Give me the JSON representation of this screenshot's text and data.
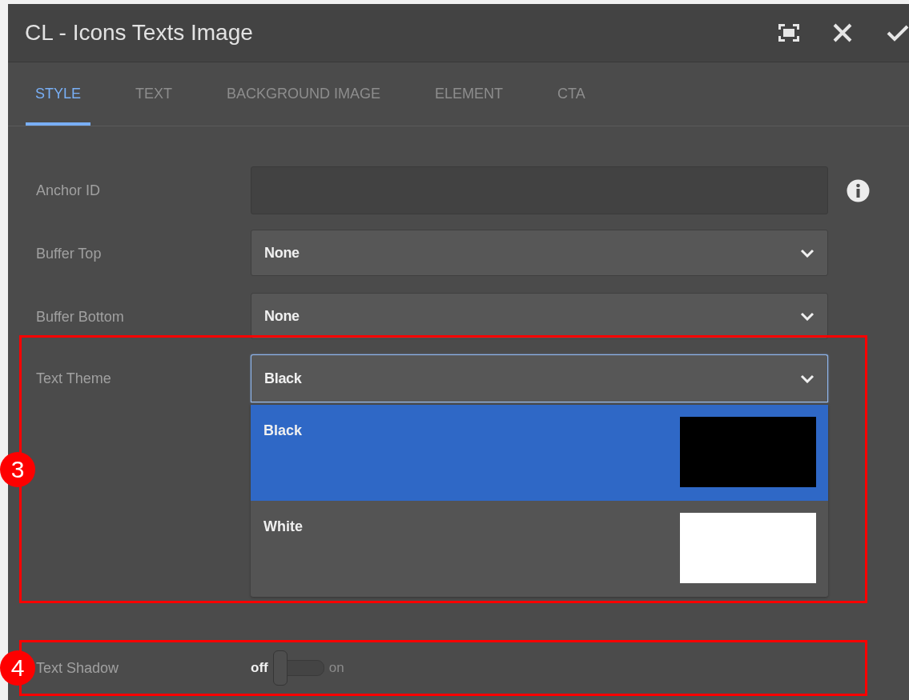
{
  "window": {
    "title": "CL - Icons Texts Image"
  },
  "tabs": [
    {
      "label": "STYLE",
      "selected": true
    },
    {
      "label": "TEXT",
      "selected": false
    },
    {
      "label": "BACKGROUND IMAGE",
      "selected": false
    },
    {
      "label": "ELEMENT",
      "selected": false
    },
    {
      "label": "CTA",
      "selected": false
    }
  ],
  "fields": [
    {
      "kind": "text",
      "label": "Anchor ID",
      "info_icon": true
    },
    {
      "kind": "select",
      "label": "Buffer Top",
      "value": "None",
      "focused": false,
      "expanded": false
    },
    {
      "kind": "select",
      "label": "Buffer Bottom",
      "value": "None",
      "focused": false,
      "expanded": false
    },
    {
      "kind": "select",
      "label": "Text Theme",
      "value": "Black",
      "focused": true,
      "expanded": true,
      "annotation": "3",
      "options": [
        {
          "label": "Black",
          "color": "#000000",
          "selected": true
        },
        {
          "label": "White",
          "color": "#ffffff",
          "selected": false
        }
      ]
    },
    {
      "kind": "toggle",
      "label": "Text Shadow",
      "off_label": "off",
      "on_label": "on",
      "on": false,
      "annotation": "4"
    }
  ]
}
